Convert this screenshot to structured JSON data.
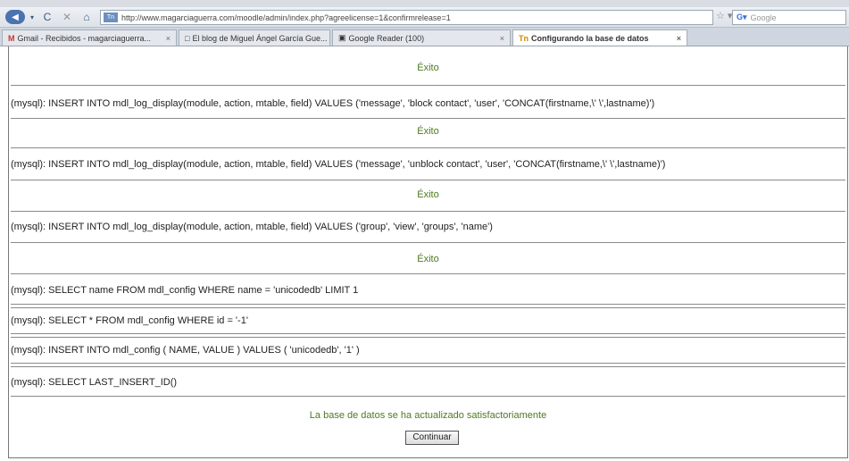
{
  "browser": {
    "url": "http://www.magarciaguerra.com/moodle/admin/index.php?agreelicense=1&confirmrelease=1",
    "favicon_text": "Tn",
    "search_placeholder": "Google",
    "tabs": [
      {
        "label": "Gmail - Recibidos - magarciaguerra...",
        "icon": "M"
      },
      {
        "label": "El blog de Miguel Ángel García Gue...",
        "icon": "□"
      },
      {
        "label": "Google Reader (100)",
        "icon": "▣"
      },
      {
        "label": "Configurando la base de datos",
        "icon": "Tn"
      }
    ]
  },
  "log": {
    "success_1": "Éxito",
    "query_1": "(mysql): INSERT INTO mdl_log_display(module, action, mtable, field) VALUES ('message', 'block contact', 'user', 'CONCAT(firstname,\\' \\',lastname)')",
    "success_2": "Éxito",
    "query_2": "(mysql): INSERT INTO mdl_log_display(module, action, mtable, field) VALUES ('message', 'unblock contact', 'user', 'CONCAT(firstname,\\' \\',lastname)')",
    "success_3": "Éxito",
    "query_3": "(mysql): INSERT INTO mdl_log_display(module, action, mtable, field) VALUES ('group', 'view', 'groups', 'name')",
    "success_4": "Éxito",
    "query_4": "(mysql): SELECT name FROM mdl_config WHERE name = 'unicodedb' LIMIT 1",
    "query_5": "(mysql): SELECT * FROM mdl_config WHERE id = '-1'",
    "query_6": "(mysql): INSERT INTO mdl_config ( NAME, VALUE ) VALUES ( 'unicodedb', '1' )",
    "query_7": "(mysql): SELECT LAST_INSERT_ID()"
  },
  "final_message": "La base de datos se ha actualizado satisfactoriamente",
  "continue_label": "Continuar"
}
